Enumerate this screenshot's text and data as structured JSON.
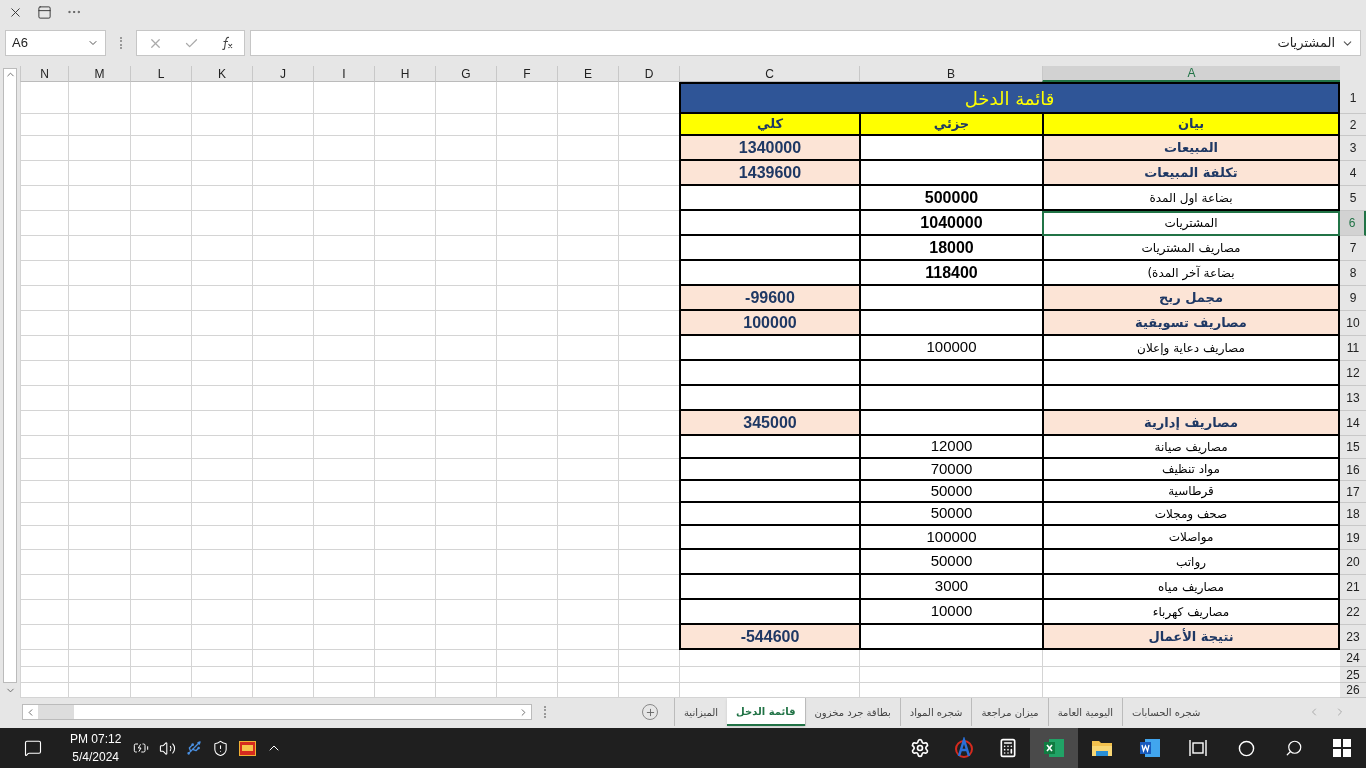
{
  "name_box": "A6",
  "formula": "المشتريات",
  "columns": [
    {
      "label": "A",
      "selected": true
    },
    {
      "label": "B",
      "selected": false
    },
    {
      "label": "C",
      "selected": false
    },
    {
      "label": "D",
      "selected": false
    },
    {
      "label": "E",
      "selected": false
    },
    {
      "label": "F",
      "selected": false
    },
    {
      "label": "G",
      "selected": false
    },
    {
      "label": "H",
      "selected": false
    },
    {
      "label": "I",
      "selected": false
    },
    {
      "label": "J",
      "selected": false
    },
    {
      "label": "K",
      "selected": false
    },
    {
      "label": "L",
      "selected": false
    },
    {
      "label": "M",
      "selected": false
    },
    {
      "label": "N",
      "selected": false
    }
  ],
  "rows": [
    {
      "number": "1",
      "kind": "title",
      "selected": false,
      "title": "قائمة الدخل"
    },
    {
      "number": "2",
      "kind": "header",
      "selected": false,
      "label": "بيان",
      "partial": "جزئي",
      "total": "كلي"
    },
    {
      "number": "3",
      "kind": "section",
      "selected": false,
      "label": "المبيعات",
      "total": "1340000"
    },
    {
      "number": "4",
      "kind": "section",
      "selected": false,
      "label": "تكلفة المبيعات",
      "total": "1439600"
    },
    {
      "number": "5",
      "kind": "detail",
      "selected": false,
      "emphasized": true,
      "label": "بضاعة اول المدة",
      "partial": "500000"
    },
    {
      "number": "6",
      "kind": "detail",
      "selected": true,
      "emphasized": true,
      "label": "المشتريات",
      "partial": "1040000"
    },
    {
      "number": "7",
      "kind": "detail",
      "selected": false,
      "emphasized": true,
      "label": "مصاريف المشتريات",
      "partial": "18000"
    },
    {
      "number": "8",
      "kind": "detail",
      "selected": false,
      "emphasized": true,
      "label": "بضاعة آخر المدة)",
      "partial": "118400"
    },
    {
      "number": "9",
      "kind": "section",
      "selected": false,
      "label": "مجمل ربح",
      "total": "-99600"
    },
    {
      "number": "10",
      "kind": "section",
      "selected": false,
      "label": "مصاريف تسويقية",
      "total": "100000"
    },
    {
      "number": "11",
      "kind": "detail",
      "selected": false,
      "emphasized": false,
      "label": "مصاريف دعاية وإعلان",
      "partial": "100000"
    },
    {
      "number": "12",
      "kind": "blank",
      "selected": false
    },
    {
      "number": "13",
      "kind": "blank",
      "selected": false
    },
    {
      "number": "14",
      "kind": "section",
      "selected": false,
      "label": "مصاريف إدارية",
      "total": "345000"
    },
    {
      "number": "15",
      "kind": "detail",
      "selected": false,
      "emphasized": false,
      "label": "مصاريف صيانة",
      "partial": "12000"
    },
    {
      "number": "16",
      "kind": "detail",
      "selected": false,
      "emphasized": false,
      "label": "مواد تنظيف",
      "partial": "70000"
    },
    {
      "number": "17",
      "kind": "detail",
      "selected": false,
      "emphasized": false,
      "label": "قرطاسية",
      "partial": "50000"
    },
    {
      "number": "18",
      "kind": "detail",
      "selected": false,
      "emphasized": false,
      "label": "صحف ومجلات",
      "partial": "50000"
    },
    {
      "number": "19",
      "kind": "detail",
      "selected": false,
      "emphasized": false,
      "label": "مواصلات",
      "partial": "100000"
    },
    {
      "number": "20",
      "kind": "detail",
      "selected": false,
      "emphasized": false,
      "label": "رواتب",
      "partial": "50000"
    },
    {
      "number": "21",
      "kind": "detail",
      "selected": false,
      "emphasized": false,
      "label": "مصاريف مياه",
      "partial": "3000"
    },
    {
      "number": "22",
      "kind": "detail",
      "selected": false,
      "emphasized": false,
      "label": "مصاريف كهرباء",
      "partial": "10000"
    },
    {
      "number": "23",
      "kind": "section",
      "selected": false,
      "label": "نتيجة الأعمال",
      "total": "-544600"
    },
    {
      "number": "24",
      "kind": "empty",
      "selected": false
    },
    {
      "number": "25",
      "kind": "empty",
      "selected": false
    },
    {
      "number": "26",
      "kind": "empty",
      "selected": false
    }
  ],
  "sheet_tabs": [
    {
      "label": "شجره الحسابات",
      "selected": false
    },
    {
      "label": "اليومية العامة",
      "selected": false
    },
    {
      "label": "ميزان مراجعة",
      "selected": false
    },
    {
      "label": "شجره المواد",
      "selected": false
    },
    {
      "label": "بطاقة جرد مخزون",
      "selected": false
    },
    {
      "label": "قائمة الدخل",
      "selected": true
    },
    {
      "label": "الميزانية",
      "selected": false
    }
  ],
  "taskbar": {
    "time": "PM 07:12",
    "date": "5/4/2024"
  }
}
